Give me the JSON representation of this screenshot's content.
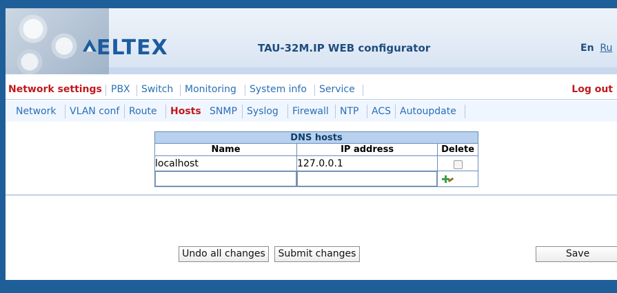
{
  "header": {
    "brand": "ELTEX",
    "title": "TAU-32M.IP WEB configurator",
    "lang_en": "En",
    "lang_ru": "Ru"
  },
  "menu": {
    "items": [
      "Network settings",
      "PBX",
      "Switch",
      "Monitoring",
      "System info",
      "Service"
    ],
    "logout": "Log out"
  },
  "submenu": {
    "items": [
      "Network",
      "VLAN conf",
      "Route",
      "Hosts",
      "SNMP",
      "Syslog",
      "Firewall",
      "NTP",
      "ACS",
      "Autoupdate"
    ]
  },
  "dns": {
    "title": "DNS hosts",
    "columns": [
      "Name",
      "IP address",
      "Delete"
    ],
    "rows": [
      {
        "name": "localhost",
        "ip": "127.0.0.1"
      }
    ]
  },
  "buttons": {
    "undo": "Undo all changes",
    "submit": "Submit changes",
    "save": "Save"
  },
  "icons": {
    "logo": "eltex-logo-icon",
    "add": "add-row-icon",
    "checkbox": "checkbox-icon"
  },
  "colors": {
    "primary": "#1f5f99",
    "accent": "#c0191d",
    "link": "#2a6fb6",
    "table_header": "#b7d1ef"
  }
}
